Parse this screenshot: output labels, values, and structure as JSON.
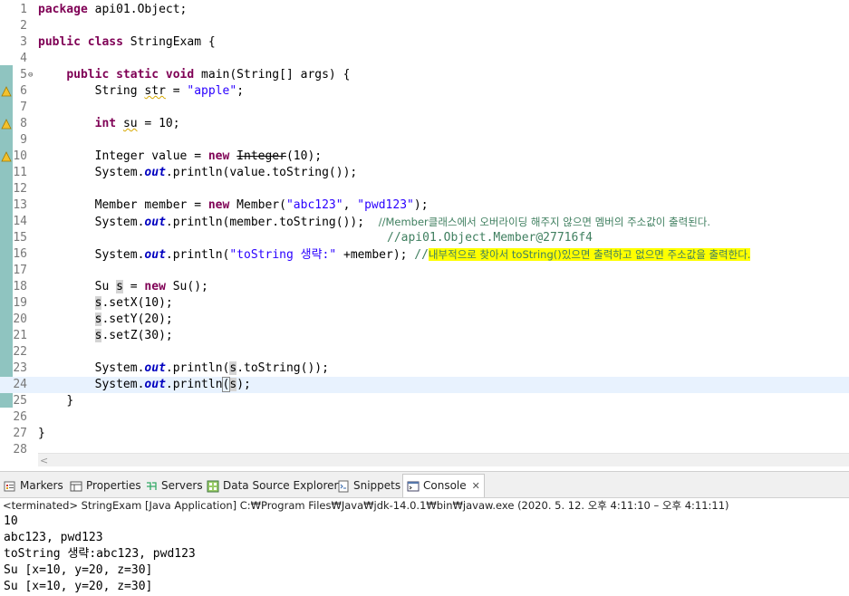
{
  "editor": {
    "lines": [
      {
        "n": "1"
      },
      {
        "n": "2"
      },
      {
        "n": "3"
      },
      {
        "n": "4"
      },
      {
        "n": "5"
      },
      {
        "n": "6"
      },
      {
        "n": "7"
      },
      {
        "n": "8"
      },
      {
        "n": "9"
      },
      {
        "n": "10"
      },
      {
        "n": "11"
      },
      {
        "n": "12"
      },
      {
        "n": "13"
      },
      {
        "n": "14"
      },
      {
        "n": "15"
      },
      {
        "n": "16"
      },
      {
        "n": "17"
      },
      {
        "n": "18"
      },
      {
        "n": "19"
      },
      {
        "n": "20"
      },
      {
        "n": "21"
      },
      {
        "n": "22"
      },
      {
        "n": "23"
      },
      {
        "n": "24"
      },
      {
        "n": "25"
      },
      {
        "n": "26"
      },
      {
        "n": "27"
      },
      {
        "n": "28"
      }
    ],
    "fold_marker": "⊖",
    "code": {
      "l1_kw": "package",
      "l1_rest": " api01.Object;",
      "l3_kw1": "public",
      "l3_kw2": "class",
      "l3_rest": " StringExam {",
      "l5_kw1": "public",
      "l5_kw2": "static",
      "l5_kw3": "void",
      "l5_rest": " main(String[] args) {",
      "l6_a": "String ",
      "l6_var": "str",
      "l6_b": " = ",
      "l6_str": "\"apple\"",
      "l6_c": ";",
      "l8_kw": "int",
      "l8_sp": " ",
      "l8_var": "su",
      "l8_rest": " = 10;",
      "l10_a": "Integer value = ",
      "l10_kw": "new",
      "l10_sp": " ",
      "l10_dep": "Integer",
      "l10_rest": "(10);",
      "l11_a": "System.",
      "l11_fld": "out",
      "l11_rest": ".println(value.toString());",
      "l13_a": "Member member = ",
      "l13_kw": "new",
      "l13_b": " Member(",
      "l13_s1": "\"abc123\"",
      "l13_c": ", ",
      "l13_s2": "\"pwd123\"",
      "l13_d": ");",
      "l14_a": "System.",
      "l14_fld": "out",
      "l14_rest": ".println(member.toString());  ",
      "l14_cmt": "//Member클래스에서 오버라이딩 해주지 않으면 멤버의 주소값이 출력된다.",
      "l15_cmt": "//api01.Object.Member@27716f4",
      "l16_a": "System.",
      "l16_fld": "out",
      "l16_b": ".println(",
      "l16_str": "\"toString 생략:\"",
      "l16_rest": " +member); ",
      "l16_cmt": "//",
      "l16_hl": "내부적으로 찾아서 toString()있으면 출력하고 없으면 주소값을 출력한다.",
      "l18_a": "Su ",
      "l18_var": "s",
      "l18_b": " = ",
      "l18_kw": "new",
      "l18_rest": " Su();",
      "l19_var": "s",
      "l19_rest": ".setX(10);",
      "l20_var": "s",
      "l20_rest": ".setY(20);",
      "l21_var": "s",
      "l21_rest": ".setZ(30);",
      "l23_a": "System.",
      "l23_fld": "out",
      "l23_b": ".println(",
      "l23_var": "s",
      "l23_rest": ".toString());",
      "l24_a": "System.",
      "l24_fld": "out",
      "l24_b": ".println",
      "l24_paren": "(",
      "l24_var": "s",
      "l24_rest": ");",
      "l25": "}",
      "l27": "}"
    }
  },
  "scrollbar": {
    "left_arrow": "<"
  },
  "panel": {
    "tabs": [
      {
        "label": "Markers"
      },
      {
        "label": "Properties"
      },
      {
        "label": "Servers"
      },
      {
        "label": "Data Source Explorer"
      },
      {
        "label": "Snippets"
      },
      {
        "label": "Console"
      }
    ],
    "close_glyph": "✕",
    "status": "<terminated> StringExam [Java Application] C:₩Program Files₩Java₩jdk-14.0.1₩bin₩javaw.exe  (2020. 5. 12. 오후 4:11:10 – 오후 4:11:11)"
  },
  "console": {
    "lines": [
      "10",
      "abc123, pwd123",
      "toString 생략:abc123, pwd123",
      "Su [x=10, y=20, z=30]",
      "Su [x=10, y=20, z=30]"
    ]
  },
  "colors": {
    "keyword": "#7f0055",
    "string": "#2a00ff",
    "comment": "#3f7f5f",
    "field": "#0000c0",
    "highlight": "#ffff00",
    "gutter_bar": "#8fc4c0"
  },
  "icons": [
    "markers-icon",
    "properties-icon",
    "servers-icon",
    "data-source-explorer-icon",
    "snippets-icon",
    "console-icon",
    "warning-icon",
    "fold-icon"
  ]
}
